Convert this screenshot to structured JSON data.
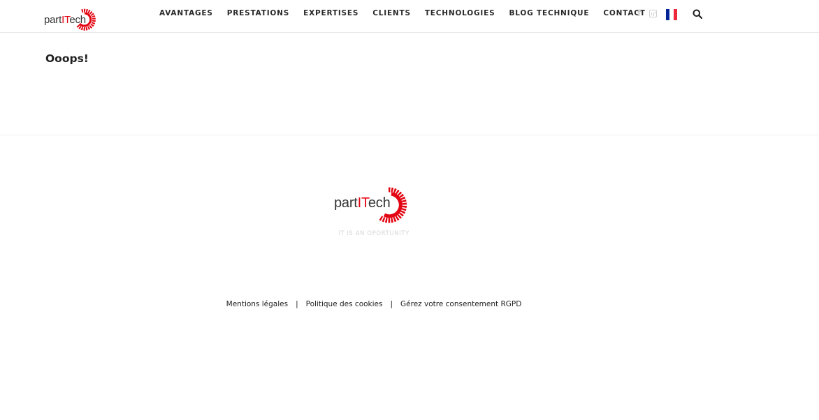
{
  "header": {
    "logo": {
      "prefix": "part",
      "highlight": "IT",
      "suffix": "ech",
      "t_letter": "T"
    },
    "nav": [
      "AVANTAGES",
      "PRESTATIONS",
      "EXPERTISES",
      "CLIENTS",
      "TECHNOLOGIES",
      "BLOG TECHNIQUE",
      "CONTACT"
    ],
    "social_icons": [
      "facebook-icon",
      "linkedin-icon"
    ],
    "language_flag": {
      "name": "french-flag-icon",
      "colors": [
        "#002395",
        "#ffffff",
        "#ed2939"
      ]
    },
    "search_icon": "search-icon"
  },
  "main": {
    "title": "Ooops!"
  },
  "footer": {
    "tagline": "IT IS AN OPORTUNITY",
    "links": [
      "Mentions légales",
      "Politique des cookies",
      "Gérez votre consentement RGPD"
    ],
    "separator": "|"
  },
  "colors": {
    "brand_red": "#e30613",
    "text": "#222222",
    "muted_icon": "#cfcfcf"
  }
}
